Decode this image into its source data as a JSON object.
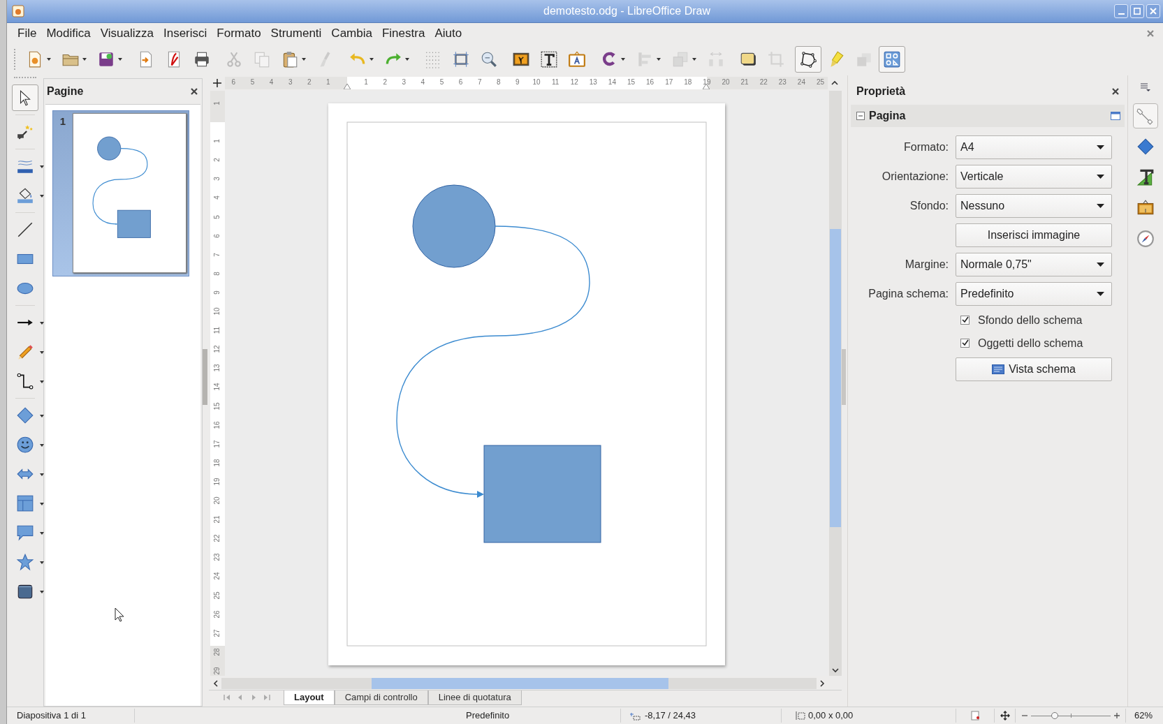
{
  "window": {
    "title": "demotesto.odg - LibreOffice Draw"
  },
  "menu": [
    "File",
    "Modifica",
    "Visualizza",
    "Inserisci",
    "Formato",
    "Strumenti",
    "Cambia",
    "Finestra",
    "Aiuto"
  ],
  "toolbar": [
    [
      {
        "kind": "new",
        "disabled": false,
        "on": false
      },
      {
        "kind": "open",
        "disabled": false,
        "on": false
      },
      {
        "kind": "save",
        "disabled": false,
        "on": false
      }
    ],
    [
      {
        "kind": "export",
        "disabled": false,
        "on": false
      },
      {
        "kind": "pdf",
        "disabled": false,
        "on": false
      },
      {
        "kind": "print",
        "disabled": false,
        "on": false
      }
    ],
    [
      {
        "kind": "cut",
        "disabled": true,
        "on": false
      },
      {
        "kind": "copy",
        "disabled": true,
        "on": false
      },
      {
        "kind": "paste",
        "disabled": false,
        "on": false
      },
      {
        "kind": "clone",
        "disabled": true,
        "on": false
      }
    ],
    [
      {
        "kind": "undo",
        "disabled": false,
        "on": false
      },
      {
        "kind": "redo",
        "disabled": false,
        "on": false
      }
    ],
    [
      {
        "kind": "grid",
        "disabled": false,
        "on": false
      },
      {
        "kind": "helplines",
        "disabled": false,
        "on": false
      },
      {
        "kind": "zoom",
        "disabled": false,
        "on": false
      }
    ],
    [
      {
        "kind": "image",
        "disabled": false,
        "on": false
      },
      {
        "kind": "textbox",
        "disabled": false,
        "on": false
      },
      {
        "kind": "fontwork",
        "disabled": false,
        "on": false
      }
    ],
    [
      {
        "kind": "rotate",
        "disabled": false,
        "on": false
      },
      {
        "kind": "align",
        "disabled": true,
        "on": false
      },
      {
        "kind": "arrange",
        "disabled": true,
        "on": false
      },
      {
        "kind": "distribute",
        "disabled": true,
        "on": false
      }
    ],
    [
      {
        "kind": "shadow",
        "disabled": false,
        "on": false
      },
      {
        "kind": "crop",
        "disabled": true,
        "on": false
      }
    ],
    [
      {
        "kind": "points",
        "disabled": false,
        "on": true
      },
      {
        "kind": "glue",
        "disabled": false,
        "on": false
      },
      {
        "kind": "extrusion",
        "disabled": true,
        "on": false
      },
      {
        "kind": "shapes",
        "disabled": false,
        "on": true
      }
    ]
  ],
  "tools": [
    [
      {
        "kind": "select",
        "selected": true
      }
    ],
    [
      {
        "kind": "fontwork",
        "selected": false
      }
    ],
    [
      {
        "kind": "line-color",
        "selected": false
      },
      {
        "kind": "fill-color",
        "selected": false
      }
    ],
    [
      {
        "kind": "line",
        "selected": false
      },
      {
        "kind": "rect",
        "selected": false
      },
      {
        "kind": "ellipse",
        "selected": false
      }
    ],
    [
      {
        "kind": "arrow",
        "selected": false
      },
      {
        "kind": "pencil",
        "selected": false
      },
      {
        "kind": "connector",
        "selected": false
      }
    ],
    [
      {
        "kind": "diamond",
        "selected": false
      },
      {
        "kind": "smiley",
        "selected": false
      },
      {
        "kind": "double-arrow",
        "selected": false
      },
      {
        "kind": "flowchart",
        "selected": false
      },
      {
        "kind": "callout",
        "selected": false
      },
      {
        "kind": "star",
        "selected": false
      },
      {
        "kind": "cube",
        "selected": false
      }
    ]
  ],
  "pages_panel": {
    "title": "Pagine",
    "pages": [
      {
        "number": "1",
        "selected": true
      }
    ]
  },
  "rulers": {
    "horizontal": [
      "6",
      "5",
      "4",
      "3",
      "2",
      "1",
      "1",
      "2",
      "3",
      "4",
      "5",
      "6",
      "7",
      "8",
      "9",
      "10",
      "11",
      "12",
      "13",
      "14",
      "15",
      "16",
      "17",
      "18",
      "19",
      "20",
      "21",
      "22",
      "23",
      "24",
      "25"
    ],
    "vertical": [
      "1",
      "1",
      "2",
      "3",
      "4",
      "5",
      "6",
      "7",
      "8",
      "9",
      "10",
      "11",
      "12",
      "13",
      "14",
      "15",
      "16",
      "17",
      "18",
      "19",
      "20",
      "21",
      "22",
      "23",
      "24",
      "25",
      "26",
      "27",
      "28",
      "29"
    ]
  },
  "properties": {
    "title": "Proprietà",
    "section": {
      "title": "Pagina",
      "expanded": true
    },
    "rows": [
      {
        "kind": "dropdown",
        "label": "Formato:",
        "value": "A4"
      },
      {
        "kind": "dropdown",
        "label": "Orientazione:",
        "value": "Verticale"
      },
      {
        "kind": "dropdown",
        "label": "Sfondo:",
        "value": "Nessuno"
      },
      {
        "kind": "button",
        "label": "Inserisci immagine",
        "icon": false
      },
      {
        "kind": "dropdown",
        "label": "Margine:",
        "value": "Normale 0,75\""
      },
      {
        "kind": "dropdown",
        "label": "Pagina schema:",
        "value": "Predefinito"
      },
      {
        "kind": "checkbox",
        "label": "Sfondo dello schema",
        "checked": true
      },
      {
        "kind": "checkbox",
        "label": "Oggetti dello schema",
        "checked": true
      },
      {
        "kind": "button",
        "label": "Vista schema",
        "icon": true
      }
    ]
  },
  "deck": [
    {
      "kind": "properties",
      "selected": true
    },
    {
      "kind": "shapes",
      "selected": false
    },
    {
      "kind": "styles",
      "selected": false
    },
    {
      "kind": "gallery",
      "selected": false
    },
    {
      "kind": "navigator",
      "selected": false
    }
  ],
  "layer_tabs": [
    {
      "label": "Layout",
      "selected": true
    },
    {
      "label": "Campi di controllo",
      "selected": false
    },
    {
      "label": "Linee di quotatura",
      "selected": false
    }
  ],
  "status_bar": {
    "slide": "Diapositiva 1 di 1",
    "master": "Predefinito",
    "position": "-8,17 / 24,43",
    "size": "0,00 x 0,00",
    "zoom": {
      "level": 0.3,
      "reading": "62%"
    }
  }
}
